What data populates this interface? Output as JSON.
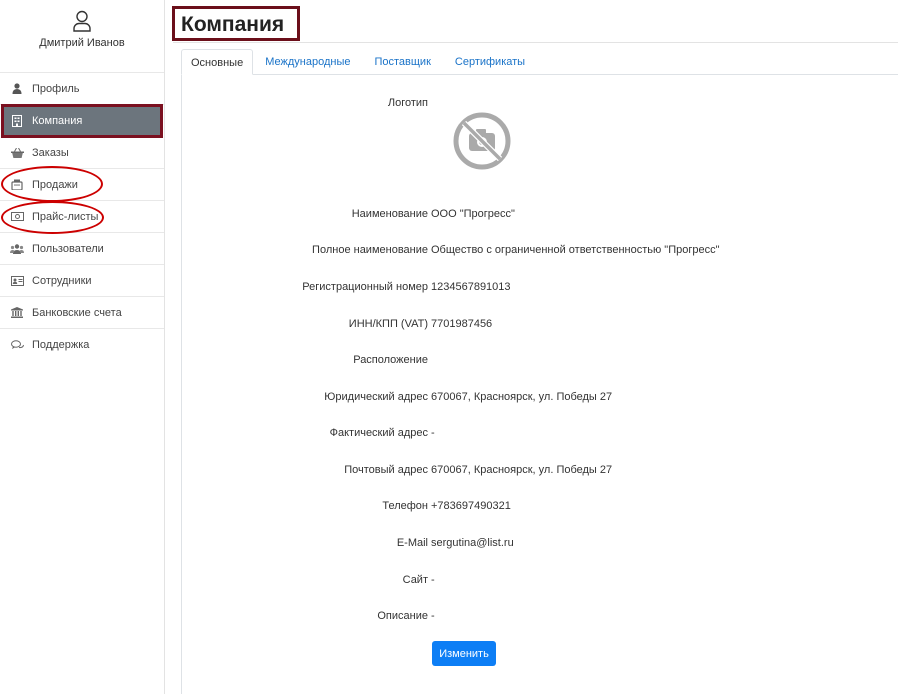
{
  "user": {
    "name": "Дмитрий Иванов",
    "icon": "user-icon"
  },
  "sidebar": {
    "items": [
      {
        "label": "Профиль",
        "icon": "person-icon"
      },
      {
        "label": "Компания",
        "icon": "building-icon",
        "active": true
      },
      {
        "label": "Заказы",
        "icon": "basket-icon"
      },
      {
        "label": "Продажи",
        "icon": "cash-register-icon"
      },
      {
        "label": "Прайс-листы",
        "icon": "money-bill-icon"
      },
      {
        "label": "Пользователи",
        "icon": "users-icon"
      },
      {
        "label": "Сотрудники",
        "icon": "id-card-icon"
      },
      {
        "label": "Банковские счета",
        "icon": "bank-icon"
      },
      {
        "label": "Поддержка",
        "icon": "comments-icon"
      }
    ]
  },
  "page": {
    "title": "Компания"
  },
  "tabs": [
    {
      "label": "Основные",
      "active": true
    },
    {
      "label": "Международные"
    },
    {
      "label": "Поставщик"
    },
    {
      "label": "Сертификаты"
    }
  ],
  "fields": {
    "logo": {
      "label": "Логотип"
    },
    "name": {
      "label": "Наименование",
      "value": "ООО \"Прогресс\""
    },
    "full_name": {
      "label": "Полное наименование",
      "value": "Общество с ограниченной ответственностью \"Прогресс\""
    },
    "reg_number": {
      "label": "Регистрационный номер",
      "value": "1234567891013"
    },
    "inn": {
      "label": "ИНН/КПП (VAT)",
      "value": "7701987456"
    },
    "location": {
      "label": "Расположение",
      "value": ""
    },
    "legal_address": {
      "label": "Юридический адрес",
      "value": "670067, Красноярск, ул. Победы 27"
    },
    "actual_address": {
      "label": "Фактический адрес",
      "value": "-"
    },
    "postal_address": {
      "label": "Почтовый адрес",
      "value": "670067, Красноярск, ул. Победы 27"
    },
    "phone": {
      "label": "Телефон",
      "value": "+783697490321"
    },
    "email": {
      "label": "E-Mail",
      "value": "sergutina@list.ru"
    },
    "site": {
      "label": "Сайт",
      "value": "-"
    },
    "description": {
      "label": "Описание",
      "value": "-"
    }
  },
  "actions": {
    "edit_label": "Изменить"
  },
  "colors": {
    "accent": "#0d7ef5",
    "active_bg": "#6c757d",
    "highlight_box": "#6b0f1a",
    "annotation_ellipse": "#cc0000"
  }
}
